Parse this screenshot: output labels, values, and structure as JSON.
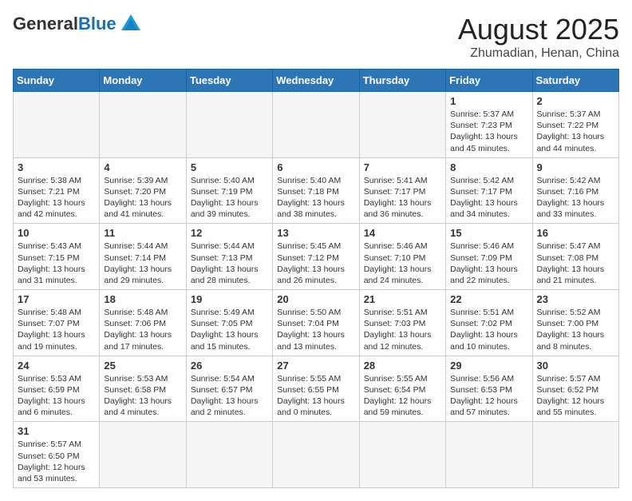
{
  "header": {
    "logo_general": "General",
    "logo_blue": "Blue",
    "month_year": "August 2025",
    "location": "Zhumadian, Henan, China"
  },
  "weekdays": [
    "Sunday",
    "Monday",
    "Tuesday",
    "Wednesday",
    "Thursday",
    "Friday",
    "Saturday"
  ],
  "weeks": [
    [
      {
        "day": "",
        "info": ""
      },
      {
        "day": "",
        "info": ""
      },
      {
        "day": "",
        "info": ""
      },
      {
        "day": "",
        "info": ""
      },
      {
        "day": "",
        "info": ""
      },
      {
        "day": "1",
        "info": "Sunrise: 5:37 AM\nSunset: 7:23 PM\nDaylight: 13 hours and 45 minutes."
      },
      {
        "day": "2",
        "info": "Sunrise: 5:37 AM\nSunset: 7:22 PM\nDaylight: 13 hours and 44 minutes."
      }
    ],
    [
      {
        "day": "3",
        "info": "Sunrise: 5:38 AM\nSunset: 7:21 PM\nDaylight: 13 hours and 42 minutes."
      },
      {
        "day": "4",
        "info": "Sunrise: 5:39 AM\nSunset: 7:20 PM\nDaylight: 13 hours and 41 minutes."
      },
      {
        "day": "5",
        "info": "Sunrise: 5:40 AM\nSunset: 7:19 PM\nDaylight: 13 hours and 39 minutes."
      },
      {
        "day": "6",
        "info": "Sunrise: 5:40 AM\nSunset: 7:18 PM\nDaylight: 13 hours and 38 minutes."
      },
      {
        "day": "7",
        "info": "Sunrise: 5:41 AM\nSunset: 7:17 PM\nDaylight: 13 hours and 36 minutes."
      },
      {
        "day": "8",
        "info": "Sunrise: 5:42 AM\nSunset: 7:17 PM\nDaylight: 13 hours and 34 minutes."
      },
      {
        "day": "9",
        "info": "Sunrise: 5:42 AM\nSunset: 7:16 PM\nDaylight: 13 hours and 33 minutes."
      }
    ],
    [
      {
        "day": "10",
        "info": "Sunrise: 5:43 AM\nSunset: 7:15 PM\nDaylight: 13 hours and 31 minutes."
      },
      {
        "day": "11",
        "info": "Sunrise: 5:44 AM\nSunset: 7:14 PM\nDaylight: 13 hours and 29 minutes."
      },
      {
        "day": "12",
        "info": "Sunrise: 5:44 AM\nSunset: 7:13 PM\nDaylight: 13 hours and 28 minutes."
      },
      {
        "day": "13",
        "info": "Sunrise: 5:45 AM\nSunset: 7:12 PM\nDaylight: 13 hours and 26 minutes."
      },
      {
        "day": "14",
        "info": "Sunrise: 5:46 AM\nSunset: 7:10 PM\nDaylight: 13 hours and 24 minutes."
      },
      {
        "day": "15",
        "info": "Sunrise: 5:46 AM\nSunset: 7:09 PM\nDaylight: 13 hours and 22 minutes."
      },
      {
        "day": "16",
        "info": "Sunrise: 5:47 AM\nSunset: 7:08 PM\nDaylight: 13 hours and 21 minutes."
      }
    ],
    [
      {
        "day": "17",
        "info": "Sunrise: 5:48 AM\nSunset: 7:07 PM\nDaylight: 13 hours and 19 minutes."
      },
      {
        "day": "18",
        "info": "Sunrise: 5:48 AM\nSunset: 7:06 PM\nDaylight: 13 hours and 17 minutes."
      },
      {
        "day": "19",
        "info": "Sunrise: 5:49 AM\nSunset: 7:05 PM\nDaylight: 13 hours and 15 minutes."
      },
      {
        "day": "20",
        "info": "Sunrise: 5:50 AM\nSunset: 7:04 PM\nDaylight: 13 hours and 13 minutes."
      },
      {
        "day": "21",
        "info": "Sunrise: 5:51 AM\nSunset: 7:03 PM\nDaylight: 13 hours and 12 minutes."
      },
      {
        "day": "22",
        "info": "Sunrise: 5:51 AM\nSunset: 7:02 PM\nDaylight: 13 hours and 10 minutes."
      },
      {
        "day": "23",
        "info": "Sunrise: 5:52 AM\nSunset: 7:00 PM\nDaylight: 13 hours and 8 minutes."
      }
    ],
    [
      {
        "day": "24",
        "info": "Sunrise: 5:53 AM\nSunset: 6:59 PM\nDaylight: 13 hours and 6 minutes."
      },
      {
        "day": "25",
        "info": "Sunrise: 5:53 AM\nSunset: 6:58 PM\nDaylight: 13 hours and 4 minutes."
      },
      {
        "day": "26",
        "info": "Sunrise: 5:54 AM\nSunset: 6:57 PM\nDaylight: 13 hours and 2 minutes."
      },
      {
        "day": "27",
        "info": "Sunrise: 5:55 AM\nSunset: 6:55 PM\nDaylight: 13 hours and 0 minutes."
      },
      {
        "day": "28",
        "info": "Sunrise: 5:55 AM\nSunset: 6:54 PM\nDaylight: 12 hours and 59 minutes."
      },
      {
        "day": "29",
        "info": "Sunrise: 5:56 AM\nSunset: 6:53 PM\nDaylight: 12 hours and 57 minutes."
      },
      {
        "day": "30",
        "info": "Sunrise: 5:57 AM\nSunset: 6:52 PM\nDaylight: 12 hours and 55 minutes."
      }
    ],
    [
      {
        "day": "31",
        "info": "Sunrise: 5:57 AM\nSunset: 6:50 PM\nDaylight: 12 hours and 53 minutes."
      },
      {
        "day": "",
        "info": ""
      },
      {
        "day": "",
        "info": ""
      },
      {
        "day": "",
        "info": ""
      },
      {
        "day": "",
        "info": ""
      },
      {
        "day": "",
        "info": ""
      },
      {
        "day": "",
        "info": ""
      }
    ]
  ]
}
